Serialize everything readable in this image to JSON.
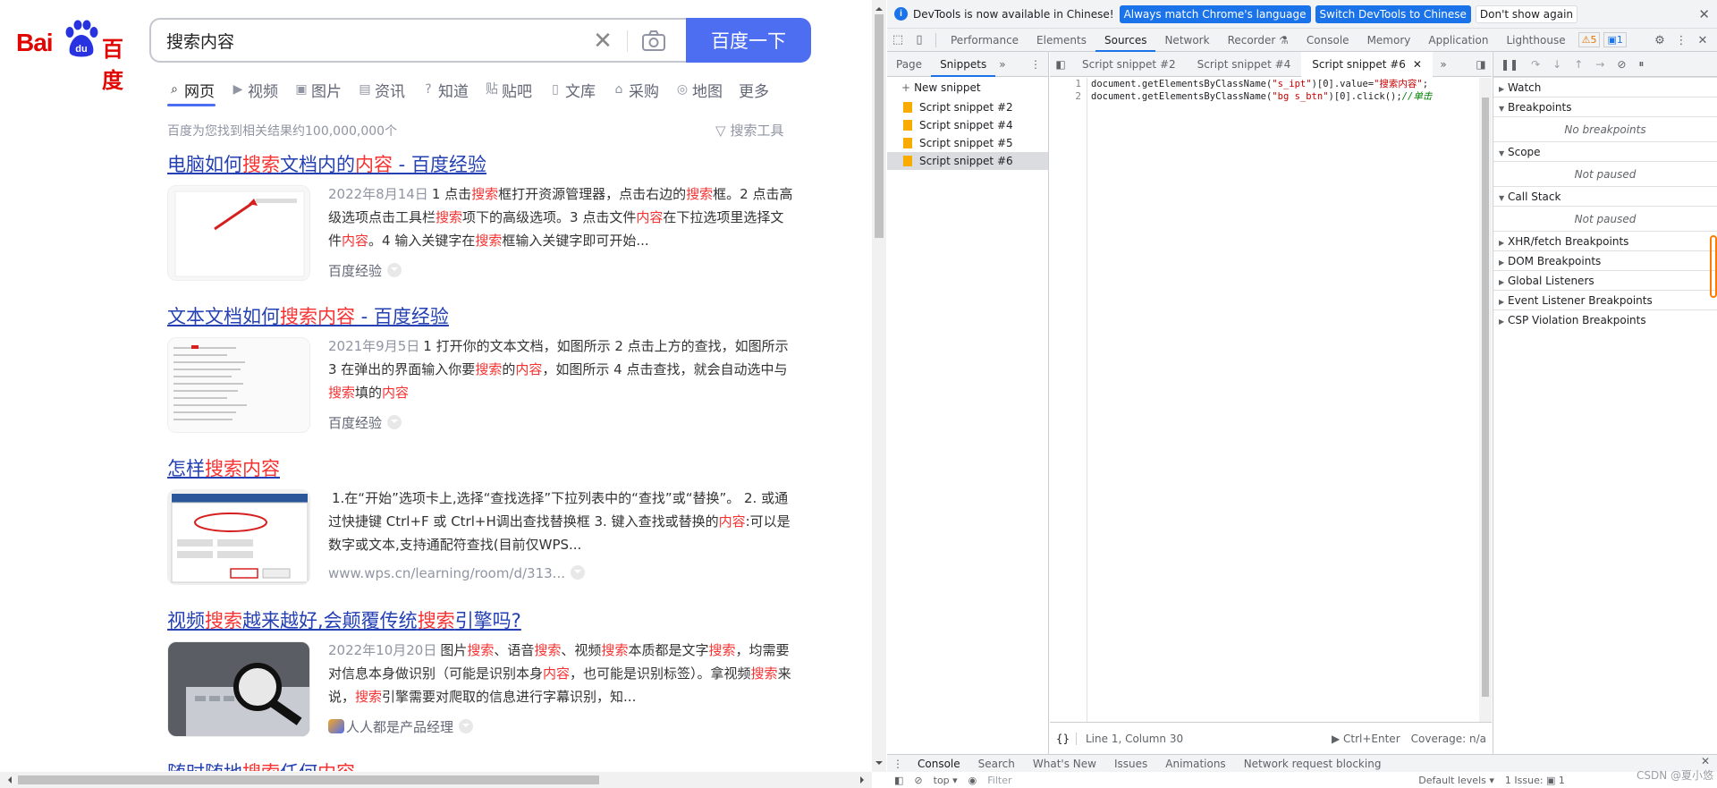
{
  "baidu": {
    "logo": {
      "latin": "Bai",
      "paw_text": "du",
      "chinese": "百度"
    },
    "search": {
      "value": "搜索内容",
      "clear": "✕",
      "button": "百度一下"
    },
    "tabs": [
      {
        "icon": "⌕",
        "label": "网页"
      },
      {
        "icon": "▶",
        "label": "视频"
      },
      {
        "icon": "▣",
        "label": "图片"
      },
      {
        "icon": "▤",
        "label": "资讯"
      },
      {
        "icon": "?",
        "label": "知道"
      },
      {
        "icon": "贴",
        "label": "贴吧"
      },
      {
        "icon": "▯",
        "label": "文库"
      },
      {
        "icon": "⌂",
        "label": "采购"
      },
      {
        "icon": "◎",
        "label": "地图"
      },
      {
        "icon": "",
        "label": "更多"
      }
    ],
    "result_count": "百度为您找到相关结果约100,000,000个",
    "search_tools": "搜索工具",
    "results": [
      {
        "title_parts": [
          "电脑如何",
          "搜索",
          "文档内的",
          "内容",
          " - 百度经验"
        ],
        "date": "2022年8月14日",
        "abstract_parts": [
          "1 点击",
          "搜索",
          "框打开资源管理器，点击右边的",
          "搜索",
          "框。2 点击高级选项点击工具栏",
          "搜索",
          "项下的高级选项。3 点击文件",
          "内容",
          "在下拉选项里选择文件",
          "内容",
          "。4 输入关键字在",
          "搜索",
          "框输入关键字即可开始..."
        ],
        "source": "百度经验"
      },
      {
        "title_parts": [
          "文本文档如何",
          "搜索内容",
          " - 百度经验"
        ],
        "date": "2021年9月5日",
        "abstract_parts": [
          "1 打开你的文本文档，如图所示 2 点击上方的查找，如图所示 3 在弹出的界面输入你要",
          "搜索",
          "的",
          "内容",
          "，如图所示 4 点击查找，就会自动选中与",
          "搜索",
          "填的",
          "内容",
          ""
        ],
        "source": "百度经验"
      },
      {
        "title_parts": [
          "怎样",
          "搜索内容",
          ""
        ],
        "date": "",
        "abstract_parts": [
          "1.在“开始”选项卡上,选择“查找选择”下拉列表中的“查找”或“替换”。 2. 或通过快捷键 Ctrl+F 或 Ctrl+H调出查找替换框 3. 键入查找或替换的",
          "内容",
          ":可以是数字或文本,支持通配符查找(目前仅WPS..."
        ],
        "source": "www.wps.cn/learning/room/d/313..."
      },
      {
        "title_parts": [
          "视频",
          "搜索",
          "越来越好,会颠覆传统",
          "搜索",
          "引擎吗?"
        ],
        "date": "2022年10月20日",
        "abstract_parts": [
          "图片",
          "搜索",
          "、语音",
          "搜索",
          "、视频",
          "搜索",
          "本质都是文字",
          "搜索",
          "，均需要对信息本身做识别（可能是识别本身",
          "内容",
          "，也可能是识别标签）。拿视频",
          "搜索",
          "来说，",
          "搜索",
          "引擎需要对爬取的信息进行字幕识别，知..."
        ],
        "source": "人人都是产品经理"
      }
    ],
    "partial_title_parts": [
      "随时随地",
      "搜索",
      "任何",
      "内容",
      ""
    ]
  },
  "devtools": {
    "infobar": {
      "message": "DevTools is now available in Chinese!",
      "btn_match": "Always match Chrome's language",
      "btn_switch": "Switch DevTools to Chinese",
      "btn_dismiss": "Don't show again"
    },
    "main_tabs": [
      "Performance",
      "Elements",
      "Sources",
      "Network",
      "Recorder ⚗",
      "Console",
      "Memory",
      "Application",
      "Lighthouse"
    ],
    "warn_count": "⚠5",
    "issue_count": "▣1",
    "nav_tabs": [
      "Page",
      "Snippets"
    ],
    "new_snippet": "New snippet",
    "snippets": [
      "Script snippet #2",
      "Script snippet #4",
      "Script snippet #5",
      "Script snippet #6"
    ],
    "editor_tabs": [
      "Script snippet #2",
      "Script snippet #4",
      "Script snippet #6"
    ],
    "code_lines": [
      {
        "num": "1",
        "a": "document.getElementsByClassName(",
        "s1": "\"s_ipt\"",
        "b": ")[0].value=",
        "s2": "\"搜索内容\"",
        "c": ";",
        "comment": ""
      },
      {
        "num": "2",
        "a": "document.getElementsByClassName(",
        "s1": "\"bg s_btn\"",
        "b": ")[0].click();",
        "s2": "",
        "c": "",
        "comment": "//单击"
      }
    ],
    "status": {
      "position": "Line 1, Column 30",
      "run": "▶ Ctrl+Enter",
      "coverage": "Coverage: n/a"
    },
    "sidebar": [
      {
        "label": "Watch",
        "open": false,
        "sub": ""
      },
      {
        "label": "Breakpoints",
        "open": true,
        "sub": "No breakpoints"
      },
      {
        "label": "Scope",
        "open": true,
        "sub": "Not paused"
      },
      {
        "label": "Call Stack",
        "open": true,
        "sub": "Not paused"
      },
      {
        "label": "XHR/fetch Breakpoints",
        "open": false,
        "sub": ""
      },
      {
        "label": "DOM Breakpoints",
        "open": false,
        "sub": ""
      },
      {
        "label": "Global Listeners",
        "open": false,
        "sub": ""
      },
      {
        "label": "Event Listener Breakpoints",
        "open": false,
        "sub": ""
      },
      {
        "label": "CSP Violation Breakpoints",
        "open": false,
        "sub": ""
      }
    ],
    "drawer_tabs": [
      "Console",
      "Search",
      "What's New",
      "Issues",
      "Animations",
      "Network request blocking"
    ],
    "console": {
      "context": "top ▾",
      "filter": "Filter",
      "levels": "Default levels ▾",
      "issue": "1 Issue: ▣ 1"
    },
    "watermark": "CSDN @夏小悠"
  },
  "colors": {
    "baidu_blue": "#4e6ef2",
    "baidu_red": "#e10602",
    "highlight": "#f73131",
    "link": "#2440b3",
    "devtools_blue": "#1a73e8"
  }
}
